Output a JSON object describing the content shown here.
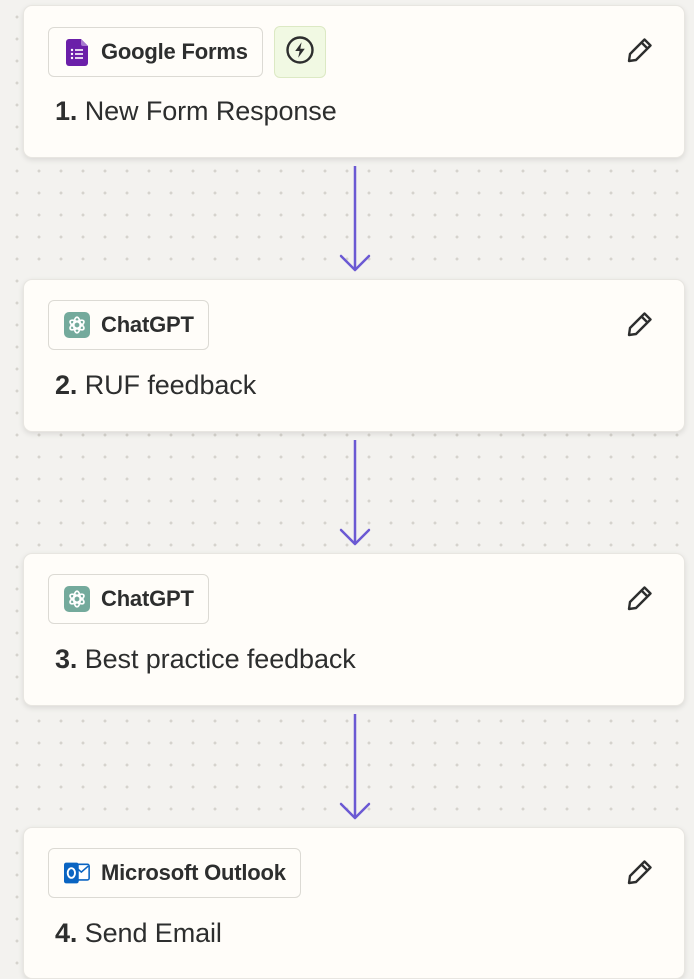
{
  "steps": [
    {
      "app_name": "Google Forms",
      "app_icon": "google-forms-icon",
      "app_color": "#6b1fa9",
      "trigger_icon": "lightning-bolt-icon",
      "number": "1.",
      "title": " New Form Response"
    },
    {
      "app_name": "ChatGPT",
      "app_icon": "chatgpt-icon",
      "app_color": "#74aa9c",
      "number": "2.",
      "title": " RUF feedback"
    },
    {
      "app_name": "ChatGPT",
      "app_icon": "chatgpt-icon",
      "app_color": "#74aa9c",
      "number": "3.",
      "title": " Best practice feedback"
    },
    {
      "app_name": "Microsoft Outlook",
      "app_icon": "microsoft-outlook-icon",
      "app_color": "#0a64c2",
      "number": "4.",
      "title": " Send Email"
    }
  ],
  "connector_color": "#6b59d3",
  "edit_icon": "pencil-icon"
}
